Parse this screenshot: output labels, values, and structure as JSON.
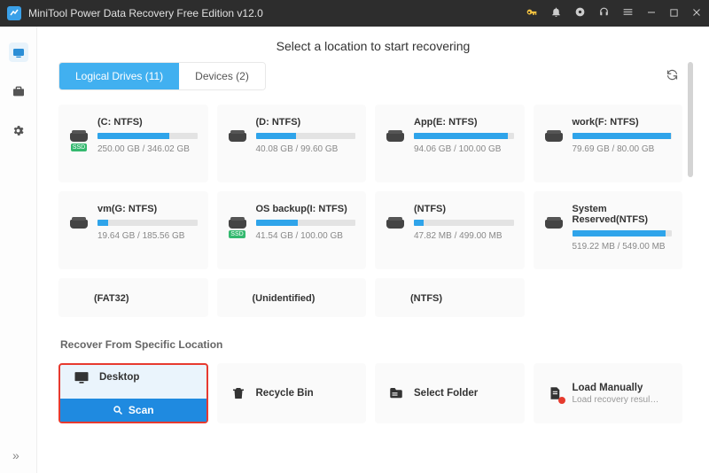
{
  "title": "MiniTool Power Data Recovery Free Edition v12.0",
  "heading": "Select a location to start recovering",
  "tabs": {
    "logical": "Logical Drives (11)",
    "devices": "Devices (2)"
  },
  "drives": [
    {
      "name": "(C: NTFS)",
      "size": "250.00 GB / 346.02 GB",
      "pct": 72,
      "ssd": true
    },
    {
      "name": "(D: NTFS)",
      "size": "40.08 GB / 99.60 GB",
      "pct": 40,
      "ssd": false
    },
    {
      "name": "App(E: NTFS)",
      "size": "94.06 GB / 100.00 GB",
      "pct": 94,
      "ssd": false
    },
    {
      "name": "work(F: NTFS)",
      "size": "79.69 GB / 80.00 GB",
      "pct": 99,
      "ssd": false
    },
    {
      "name": "vm(G: NTFS)",
      "size": "19.64 GB / 185.56 GB",
      "pct": 11,
      "ssd": false
    },
    {
      "name": "OS backup(I: NTFS)",
      "size": "41.54 GB / 100.00 GB",
      "pct": 42,
      "ssd": true
    },
    {
      "name": "(NTFS)",
      "size": "47.82 MB / 499.00 MB",
      "pct": 10,
      "ssd": false
    },
    {
      "name": "System Reserved(NTFS)",
      "size": "519.22 MB / 549.00 MB",
      "pct": 94,
      "ssd": false
    }
  ],
  "partial": [
    {
      "name": "(FAT32)"
    },
    {
      "name": "(Unidentified)"
    },
    {
      "name": "(NTFS)"
    }
  ],
  "section2": "Recover From Specific Location",
  "locations": {
    "desktop": "Desktop",
    "scan": "Scan",
    "recycle": "Recycle Bin",
    "select": "Select Folder",
    "load": "Load Manually",
    "load_sub": "Load recovery result (*..."
  }
}
